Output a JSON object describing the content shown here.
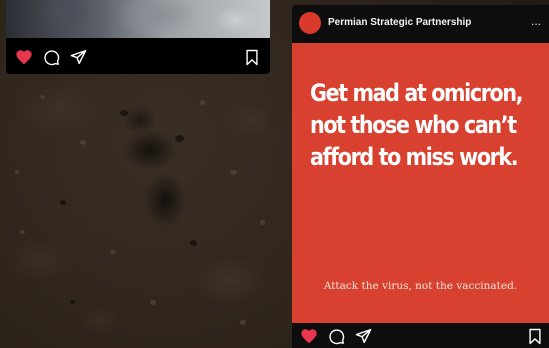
{
  "top_post": {
    "actions": [
      "like",
      "comment",
      "share",
      "save"
    ]
  },
  "right_post": {
    "account_name": "Permian Strategic Partnership",
    "more_label": "...",
    "headline_lines": [
      "Get mad at omicron,",
      "not those who can’t",
      "afford to miss work."
    ],
    "tagline": "Attack the virus, not the vaccinated."
  },
  "colors": {
    "brand_red": "#d8412f",
    "like_red": "#e8364f",
    "card_bg": "#0d0d0d"
  },
  "icons": {
    "like": "heart-icon",
    "comment": "comment-icon",
    "share": "share-icon",
    "save": "bookmark-icon"
  }
}
